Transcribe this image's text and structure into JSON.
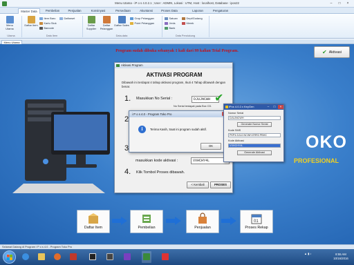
{
  "window": {
    "title": "Menu Utama - iP o s 4.0.2.1 ; User : ADMIN, Lokasi : UTM, Host : localhost, Database : ipos22"
  },
  "ribbon_tabs": [
    "Master Data",
    "Pembelian",
    "Penjualan",
    "Konsinyasi",
    "Persediaan",
    "Akuntansi",
    "Proses Data",
    "Laporan",
    "Pengaturan"
  ],
  "ribbon": {
    "utama": {
      "label": "Utama",
      "menu_utama": "Menu Utama"
    },
    "data_item": {
      "label": "Data Item",
      "daftar_item": "Daftar Item",
      "item_baru": "Item Baru",
      "kartu_stok": "Kartu Stok",
      "barcode": "Barcode",
      "daftar_set": "Daftarset"
    },
    "data_data": {
      "label": "Data-data",
      "daftar_supplier": "Daftar Supplier",
      "daftar_pelanggan": "Daftar Pelanggan",
      "daftar_sales": "Daftar Sales",
      "grup_pelanggan": "Grup Pelanggan",
      "point_pelanggan": "Point Pelanggan"
    },
    "data_pendukung": {
      "label": "Data Pendukung",
      "satuan": "Satuan",
      "jenis": "Jenis",
      "bank": "Bank",
      "dept_gudang": "Dept/Gudang",
      "merek": "Merek"
    }
  },
  "doc_tab": "Menu Utama",
  "trial_banner": "Program sudah dibuka sebanyak 1 kali dari 99 kalian Trial Program.",
  "aktivasi_button": "Aktivasi",
  "brand": {
    "big": "OKO",
    "sub": "PROFESIONAL"
  },
  "flow": {
    "daftar_item": "Daftar Item",
    "pembelian": "Pembelian",
    "penjualan": "Penjualan",
    "proses_rekap": "Proses Rekap"
  },
  "activation_dialog": {
    "title": "Aktivasi Program",
    "heading": "AKTIVASI PROGRAM",
    "description": "Dibawah ini terdapat 4 tahap aktivasi program, Ikuti 4 Tahap dibawah dengan benar.",
    "step1_num": "1.",
    "step1_label": "Masukkan No Serial :",
    "serial_value": "DJUJNCWH",
    "serial_note": "No Serial terdapat pada Box CD.",
    "step2_num": "2.",
    "step3_num": "3.",
    "step3_label": "masukkan kode aktivasi :",
    "activation_code": "VXHCHY4L",
    "step4_num": "4.",
    "step4_label": "Klik Tombol Proses dibawah.",
    "kembali_button": "< Kembali",
    "proses_button": "PROSES"
  },
  "message_box": {
    "title": "i P o s  4.0 - Program Toko Pro",
    "text": "Terima Kasih, Saat ini program sudah aktif.",
    "ok_button": "OK"
  },
  "keygen": {
    "title": "iPos 4.0.2.x KeyGen",
    "serial_label": "Nomor Serial",
    "serial_value": "DJUJNCWH",
    "gen_serial_button": "Generate Nomor Serial",
    "sms_label": "Kode SMS",
    "sms_value": "PKP4.DJUJ.NCWH.ERR2.PBHC",
    "aktivasi_label": "Kode Aktivasi",
    "aktivasi_value": "VXHCHY4L",
    "gen_aktivasi_button": "Generate Aktivasi"
  },
  "status_text": "Selamat Datang di Program i P o s  4.0 - Program Toko Pro",
  "clock": {
    "time": "8:55 AM",
    "date": "10/16/2016"
  },
  "colors": {
    "trial_red": "#c4101a",
    "brand_yellow": "#f1d021",
    "workspace_blue": "#3a7fcb",
    "check_green": "#2aa52a"
  }
}
